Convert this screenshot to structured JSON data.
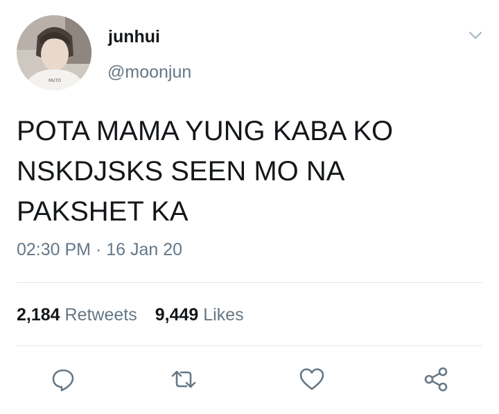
{
  "user": {
    "display_name": "junhui",
    "handle": "@moonjun",
    "avatar_icon": "profile-photo"
  },
  "tweet": {
    "lines": [
      "POTA MAMA YUNG KABA KO",
      "NSKDJSKS SEEN MO NA",
      "PAKSHET KA"
    ],
    "time": "02:30 PM",
    "separator": " · ",
    "date": "16 Jan 20"
  },
  "stats": {
    "retweets_count": "2,184",
    "retweets_label": "Retweets",
    "likes_count": "9,449",
    "likes_label": "Likes"
  },
  "actions": [
    {
      "name": "reply",
      "icon": "reply-icon"
    },
    {
      "name": "retweet",
      "icon": "retweet-icon"
    },
    {
      "name": "like",
      "icon": "heart-icon"
    },
    {
      "name": "share",
      "icon": "share-icon"
    }
  ],
  "colors": {
    "text": "#14171a",
    "secondary": "#657786",
    "divider": "#e1e8ed",
    "icon": "#657786"
  }
}
